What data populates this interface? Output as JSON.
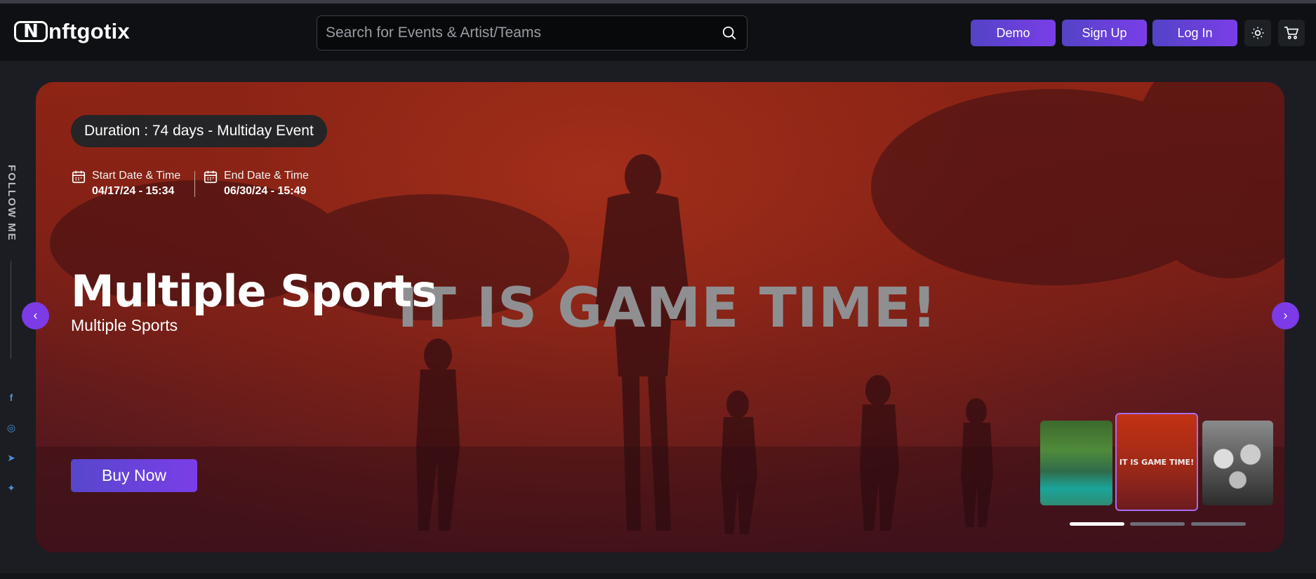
{
  "header": {
    "logo_mark": "N",
    "logo_text": "nftgotix",
    "search_placeholder": "Search for Events & Artist/Teams",
    "buttons": {
      "demo": "Demo",
      "signup": "Sign Up",
      "login": "Log In"
    },
    "icons": {
      "search": "search-icon",
      "theme": "sun-icon",
      "cart": "cart-icon"
    }
  },
  "sidebar": {
    "follow_label": "FOLLOW ME",
    "social": [
      {
        "name": "facebook-icon",
        "glyph": "f"
      },
      {
        "name": "instagram-icon",
        "glyph": "◎"
      },
      {
        "name": "telegram-icon",
        "glyph": "➤"
      },
      {
        "name": "twitter-icon",
        "glyph": "✦"
      }
    ]
  },
  "hero": {
    "duration": "Duration : 74 days - Multiday Event",
    "start_label": "Start Date & Time",
    "start_value": "04/17/24 - 15:34",
    "end_label": "End Date & Time",
    "end_value": "06/30/24 - 15:49",
    "image_text": "IT IS GAME TIME!",
    "title": "Multiple Sports",
    "subtitle": "Multiple Sports",
    "buy_label": "Buy Now",
    "prev_glyph": "‹",
    "next_glyph": "›",
    "thumbnails": [
      {
        "name": "river-thumbnail",
        "text": ""
      },
      {
        "name": "game-time-thumbnail",
        "text": "IT IS GAME TIME!"
      },
      {
        "name": "band-thumbnail",
        "text": ""
      }
    ],
    "active_slide": 1,
    "slide_count": 3
  },
  "colors": {
    "accent": "#7a3ee8",
    "accent_start": "#5343c6",
    "hero_red": "#8e2414",
    "header_bg": "#0e1013",
    "page_bg": "#1b1d22"
  }
}
